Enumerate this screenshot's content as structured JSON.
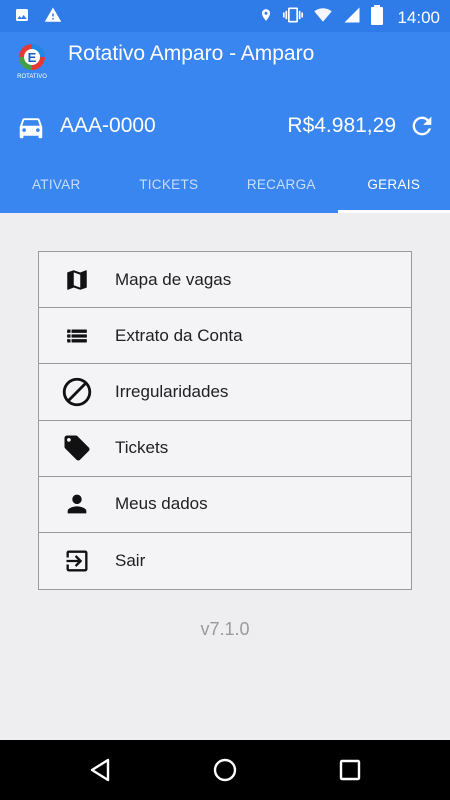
{
  "status_bar": {
    "time": "14:00",
    "icons_left": [
      "image-icon",
      "warning-icon"
    ],
    "icons_right": [
      "location-icon",
      "vibrate-icon",
      "wifi-icon",
      "signal-icon",
      "battery-icon"
    ]
  },
  "app": {
    "title": "Rotativo Amparo - Amparo",
    "logo_text": "E",
    "logo_caption": "ROTATIVO",
    "plate": "AAA-0000",
    "balance": "R$4.981,29"
  },
  "tabs": [
    {
      "label": "ATIVAR",
      "active": false
    },
    {
      "label": "TICKETS",
      "active": false
    },
    {
      "label": "RECARGA",
      "active": false
    },
    {
      "label": "GERAIS",
      "active": true
    }
  ],
  "menu": [
    {
      "label": "Mapa de vagas",
      "icon": "map-icon"
    },
    {
      "label": "Extrato da Conta",
      "icon": "list-icon"
    },
    {
      "label": "Irregularidades",
      "icon": "block-icon"
    },
    {
      "label": "Tickets",
      "icon": "tag-icon"
    },
    {
      "label": "Meus dados",
      "icon": "person-icon"
    },
    {
      "label": "Sair",
      "icon": "exit-icon"
    }
  ],
  "version": "v7.1.0",
  "colors": {
    "primary": "#3a86f0",
    "status_bar": "#2f7be8",
    "background": "#eeeef0"
  }
}
